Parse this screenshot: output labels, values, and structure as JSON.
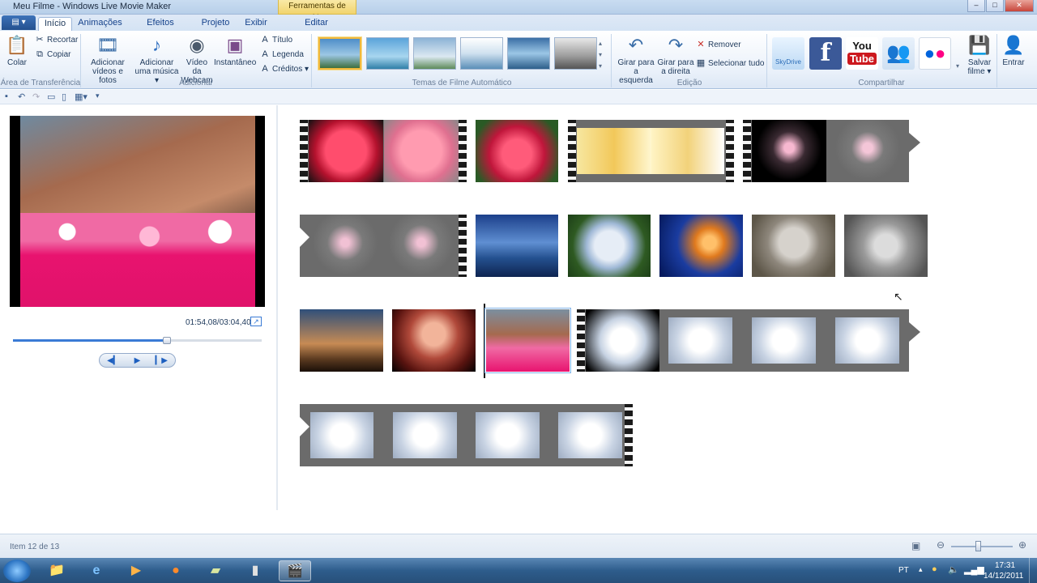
{
  "window": {
    "title": "Meu Filme - Windows Live Movie Maker",
    "context_tab_header": "Ferramentas de Vídeo",
    "controls": [
      "–",
      "□",
      "✕"
    ]
  },
  "tabs": [
    {
      "label": "Início"
    },
    {
      "label": "Animações"
    },
    {
      "label": "Efeitos Visuais"
    },
    {
      "label": "Projeto"
    },
    {
      "label": "Exibir"
    },
    {
      "label": "Editar"
    }
  ],
  "app_menu_label": "▤ ▾",
  "ribbon": {
    "clipboard": {
      "paste": "Colar",
      "cut": "Recortar",
      "copy": "Copiar",
      "group": "Área de Transferência"
    },
    "add": {
      "add_videos_l1": "Adicionar",
      "add_videos_l2": "vídeos e fotos",
      "add_music_l1": "Adicionar",
      "add_music_l2": "uma música ▾",
      "webcam_l1": "Vídeo da",
      "webcam_l2": "Webcam",
      "snapshot": "Instantâneo",
      "title": "Título",
      "caption": "Legenda",
      "credits": "Créditos ▾",
      "group": "Adicionar"
    },
    "themes": {
      "group": "Temas de Filme Automático"
    },
    "edit": {
      "rotate_left_l1": "Girar para",
      "rotate_left_l2": "a esquerda",
      "rotate_right_l1": "Girar para",
      "rotate_right_l2": "a direita",
      "remove": "Remover",
      "select_all": "Selecionar tudo",
      "group": "Edição"
    },
    "share": {
      "skydrive": "SkyDrive",
      "facebook": "f",
      "youtube_l1": "You",
      "youtube_l2": "Tube",
      "save_l1": "Salvar",
      "save_l2": "filme ▾",
      "signin": "Entrar",
      "group": "Compartilhar"
    }
  },
  "preview": {
    "time": "01:54,08/03:04,40",
    "progress": 0.62
  },
  "status": {
    "text": "Item 12 de 13"
  },
  "taskbar": {
    "lang": "PT",
    "time": "17:31",
    "date": "14/12/2011"
  },
  "colors": {
    "accent": "#3a7bd5",
    "pink": "#e8136f",
    "film": "#6b6b6b"
  }
}
